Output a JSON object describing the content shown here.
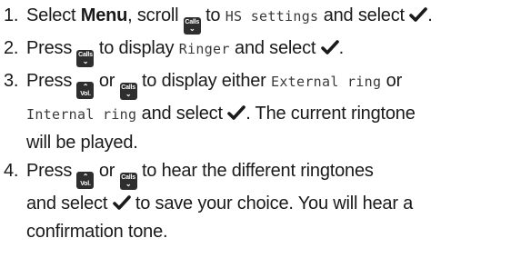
{
  "steps": [
    {
      "number": "1.",
      "parts": {
        "a": "Select ",
        "b": "Menu",
        "c": ", scroll ",
        "key1": "Calls",
        "d": " to ",
        "lcd1": "HS settings",
        "e": " and select ",
        "f": "."
      }
    },
    {
      "number": "2.",
      "parts": {
        "a": "Press ",
        "key1": "Calls",
        "b": " to display ",
        "lcd1": "Ringer",
        "c": " and select ",
        "d": "."
      }
    },
    {
      "number": "3.",
      "parts": {
        "a": "Press ",
        "key1": "Vol.",
        "b": " or ",
        "key2": "Calls",
        "c": " to display either ",
        "lcd1": "External ring",
        "d": " or",
        "lcd2": "Internal ring",
        "e": " and select ",
        "f": ". The current ringtone",
        "g": "will be played."
      }
    },
    {
      "number": "4.",
      "parts": {
        "a": "Press ",
        "key1": "Vol.",
        "b": " or ",
        "key2": "Calls",
        "c": " to hear the different ringtones",
        "d": "and select ",
        "e": " to save your choice. You will hear a",
        "f": "confirmation tone."
      }
    }
  ],
  "icons": {
    "key_up": "vol-up-key-icon",
    "key_down": "calls-down-key-icon",
    "confirm": "checkmark-icon"
  },
  "colors": {
    "text": "#1a1a1a",
    "key_bg": "#2e2e2e",
    "key_fg": "#ffffff"
  }
}
